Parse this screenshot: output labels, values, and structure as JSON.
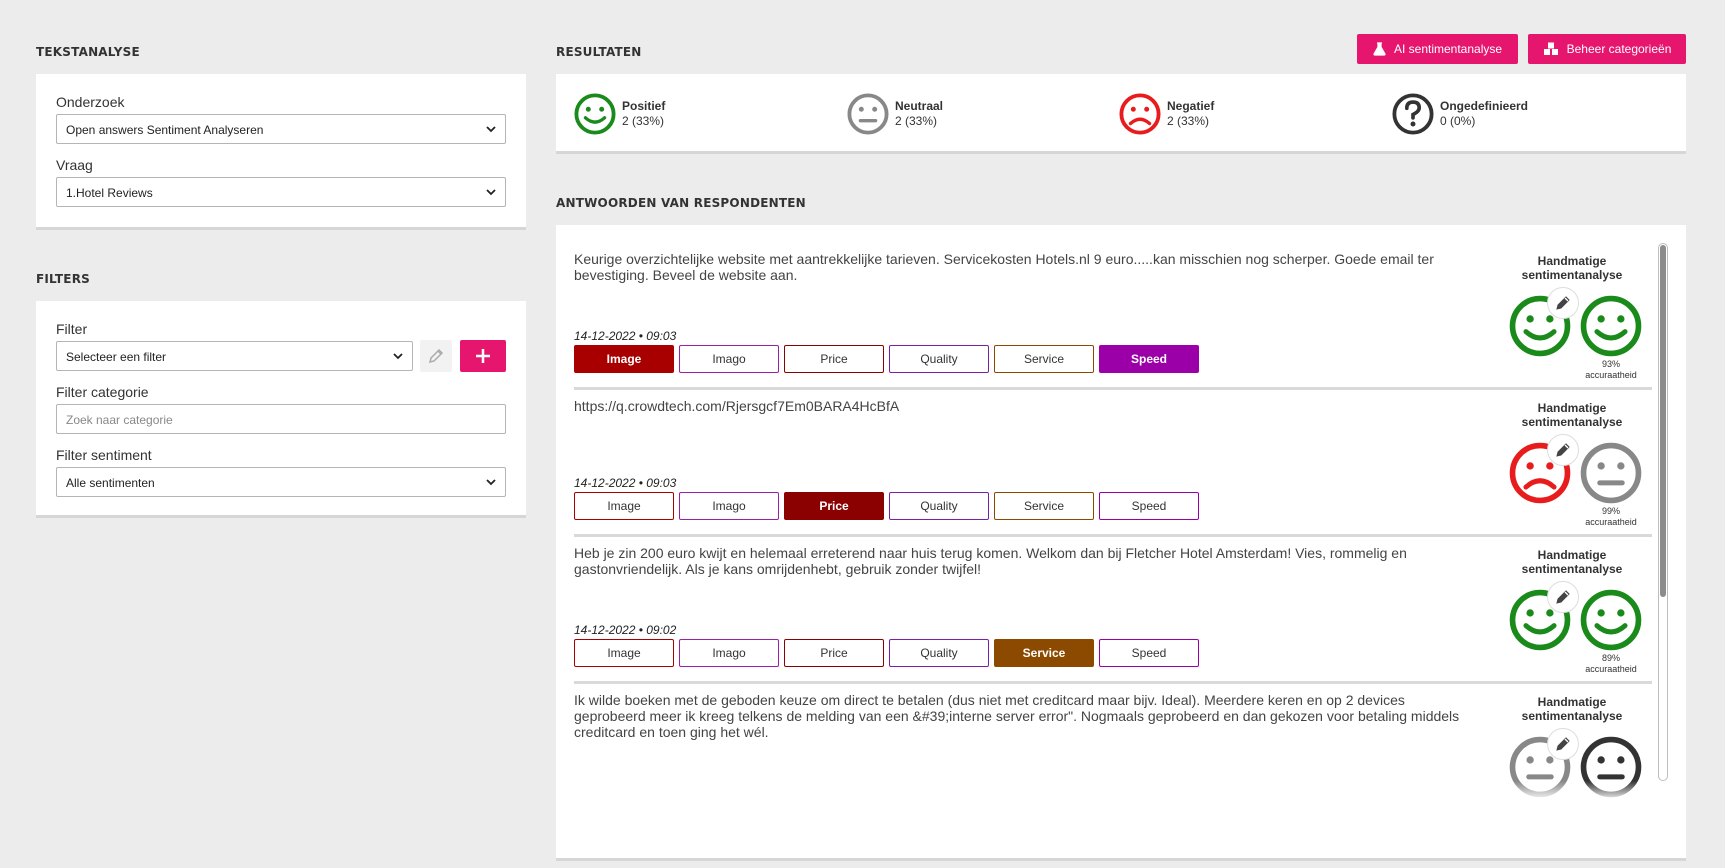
{
  "left": {
    "tekstanalyse_title": "TEKSTANALYSE",
    "onderzoek_label": "Onderzoek",
    "onderzoek_value": "Open answers Sentiment Analyseren",
    "vraag_label": "Vraag",
    "vraag_value": "1.Hotel Reviews",
    "filters_title": "FILTERS",
    "filter_label": "Filter",
    "filter_value": "Selecteer een filter",
    "filter_categorie_label": "Filter categorie",
    "filter_categorie_placeholder": "Zoek naar categorie",
    "filter_sentiment_label": "Filter sentiment",
    "filter_sentiment_value": "Alle sentimenten"
  },
  "results": {
    "title": "RESULTATEN",
    "ai_button": "AI sentimentanalyse",
    "categories_button": "Beheer categorieën",
    "summary": [
      {
        "name": "Positief",
        "value": "2 (33%)",
        "icon": "happy-face",
        "color": "#1a8a1a"
      },
      {
        "name": "Neutraal",
        "value": "2 (33%)",
        "icon": "neutral-face",
        "color": "#888888"
      },
      {
        "name": "Negatief",
        "value": "2 (33%)",
        "icon": "sad-face",
        "color": "#e81c1c"
      },
      {
        "name": "Ongedefinieerd",
        "value": "0 (0%)",
        "icon": "question-circle",
        "color": "#333333"
      }
    ]
  },
  "answers": {
    "title": "ANTWOORDEN VAN RESPONDENTEN",
    "manual_label": "Handmatige sentimentanalyse",
    "accuracy_word": "accuraatheid",
    "tag_labels": [
      "Image",
      "Imago",
      "Price",
      "Quality",
      "Service",
      "Speed"
    ],
    "tag_colors": [
      "#a80000",
      "#9b1fa8",
      "#8b0000",
      "#7b1fa8",
      "#8b4a00",
      "#9b00a8"
    ],
    "items": [
      {
        "text": "Keurige overzichtelijke website met aantrekkelijke tarieven. Servicekosten Hotels.nl 9 euro.....kan misschien nog scherper. Goede email ter bevestiging. Beveel de website aan.",
        "date": "14-12-2022 • 09:03",
        "active_tags": [
          "Image",
          "Speed"
        ],
        "manual": "positive",
        "ai": "positive",
        "accuracy": "93%"
      },
      {
        "text": "https://q.crowdtech.com/Rjersgcf7Em0BARA4HcBfA",
        "date": "14-12-2022 • 09:03",
        "active_tags": [
          "Price"
        ],
        "manual": "negative",
        "ai": "neutral",
        "accuracy": "99%"
      },
      {
        "text": "Heb je zin 200 euro kwijt en helemaal erreterend naar huis terug komen. Welkom dan bij Fletcher Hotel Amsterdam! Vies, rommelig en gastonvriendelijk. Als je kans omrijdenhebt, gebruik zonder twijfel!",
        "date": "14-12-2022 • 09:02",
        "active_tags": [
          "Service"
        ],
        "manual": "positive",
        "ai": "positive",
        "accuracy": "89%"
      },
      {
        "text": "Ik wilde boeken met de geboden keuze om direct te betalen (dus niet met creditcard maar bijv. Ideal). Meerdere keren en op 2 devices geprobeerd meer ik kreeg telkens de melding van een &#39;interne server error\". Nogmaals geprobeerd en dan gekozen voor betaling middels creditcard en toen ging het wél.",
        "date": "",
        "active_tags": [],
        "manual": "neutral",
        "ai": "neutral-dark",
        "accuracy": ""
      }
    ]
  }
}
